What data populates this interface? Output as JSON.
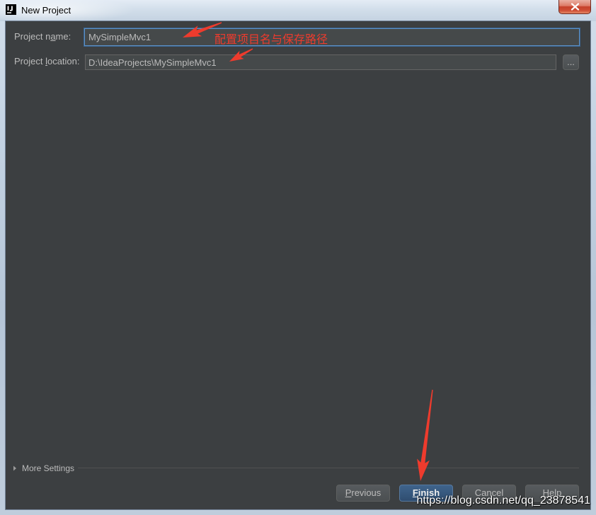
{
  "window": {
    "title": "New Project",
    "app_icon": "intellij-idea-icon",
    "close_icon": "close-icon"
  },
  "form": {
    "project_name": {
      "label": "Project name:",
      "value": "MySimpleMvc1"
    },
    "project_location": {
      "label": "Project location:",
      "value": "D:\\IdeaProjects\\MySimpleMvc1",
      "browse_label": "..."
    }
  },
  "more_settings": {
    "label": "More Settings",
    "icon": "triangle-right-icon"
  },
  "buttons": {
    "previous": "Previous",
    "finish": "Finish",
    "cancel": "Cancel",
    "help": "Help"
  },
  "annotation": {
    "text": "配置项目名与保存路径"
  },
  "watermark": {
    "text": "https://blog.csdn.net/qq_23878541"
  },
  "colors": {
    "background": "#3c3f41",
    "text": "#bbbbbb",
    "accent": "#365880",
    "focus": "#4a88c7",
    "annotation": "#ee3b2d"
  }
}
